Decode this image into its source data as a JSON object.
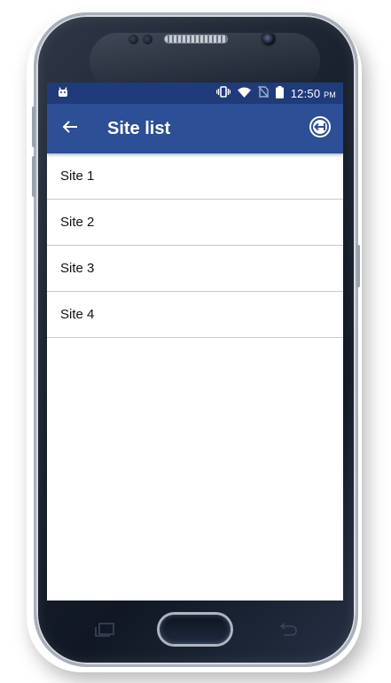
{
  "status_bar": {
    "time": "12:50",
    "ampm": "PM",
    "icons": [
      "android-icon",
      "vibrate-icon",
      "wifi-icon",
      "no-sim-icon",
      "battery-icon"
    ]
  },
  "app_bar": {
    "title": "Site list",
    "back_icon": "arrow-left-icon",
    "action_icon": "logout-circle-icon"
  },
  "sites": [
    {
      "label": "Site 1"
    },
    {
      "label": "Site 2"
    },
    {
      "label": "Site 3"
    },
    {
      "label": "Site 4"
    }
  ],
  "nav_bar": {
    "icons": [
      "recent-apps-icon",
      "home-button",
      "back-nav-icon"
    ]
  },
  "colors": {
    "status_bar": "#1f3b79",
    "app_bar": "#2d4f96",
    "divider": "#c8c8c8",
    "phone_body": "#1b2230"
  }
}
